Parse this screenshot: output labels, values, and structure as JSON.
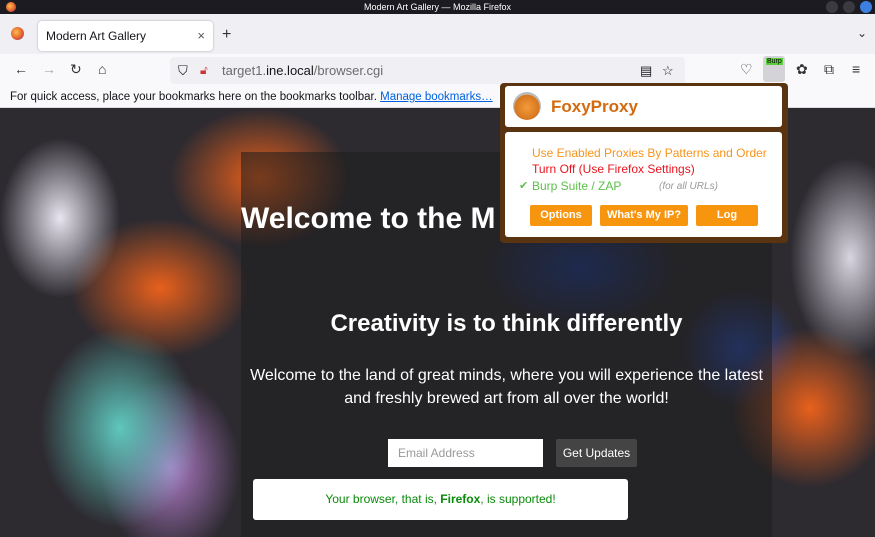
{
  "window": {
    "title": "Modern Art Gallery — Mozilla Firefox"
  },
  "tab": {
    "label": "Modern Art Gallery",
    "close": "×",
    "new_tab": "+"
  },
  "url": {
    "host_prefix": "target1.",
    "host": "ine.local",
    "path": "/browser.cgi"
  },
  "bookmarks": {
    "text": "For quick access, place your bookmarks here on the bookmarks toolbar.",
    "link": "Manage bookmarks…"
  },
  "extension": {
    "burp_badge": "Burp"
  },
  "page": {
    "heading": "Welcome to the M",
    "subheading": "Creativity is to think differently",
    "intro": "Welcome to the land of great minds, where you will experience the latest and freshly brewed art from all over the world!",
    "email_placeholder": "Email Address",
    "button": "Get Updates",
    "support_prefix": "Your browser, that is, ",
    "support_browser": "Firefox",
    "support_suffix": ", is supported!"
  },
  "foxyproxy": {
    "title": "FoxyProxy",
    "options": [
      {
        "label": "Use Enabled Proxies By Patterns and Order",
        "color": "#f7941d"
      },
      {
        "label": "Turn Off (Use Firefox Settings)",
        "color": "#e8141e"
      },
      {
        "label": "Burp Suite / ZAP",
        "color": "#5cc049",
        "selected": true,
        "note": "(for all URLs)"
      }
    ],
    "check": "✔",
    "buttons": [
      "Options",
      "What's My IP?",
      "Log"
    ]
  }
}
